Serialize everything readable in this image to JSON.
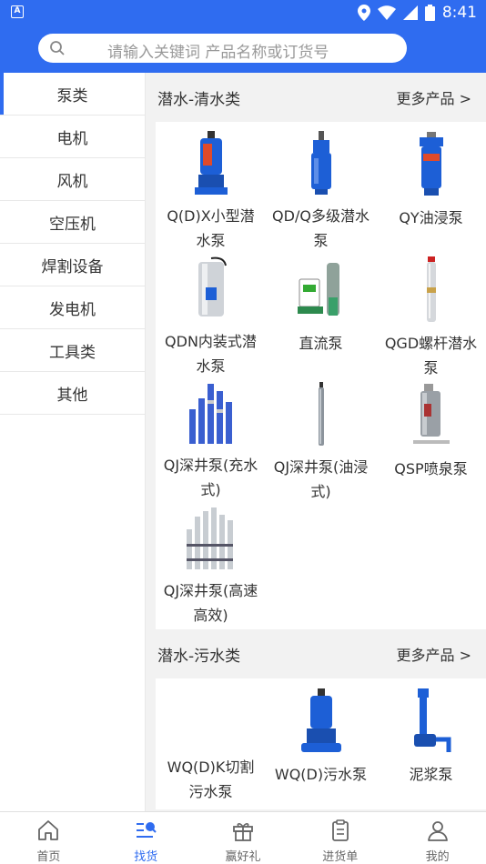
{
  "status_bar": {
    "time": "8:41",
    "app_badge": "A"
  },
  "search": {
    "placeholder": "请输入关键词 产品名称或订货号"
  },
  "sidebar": {
    "items": [
      {
        "label": "泵类",
        "active": true
      },
      {
        "label": "电机"
      },
      {
        "label": "风机"
      },
      {
        "label": "空压机"
      },
      {
        "label": "焊割设备"
      },
      {
        "label": "发电机"
      },
      {
        "label": "工具类"
      },
      {
        "label": "其他"
      }
    ]
  },
  "sections": [
    {
      "title": "潜水-清水类",
      "more": "更多产品 >",
      "products": [
        {
          "label": "Q(D)X小型潜水泵"
        },
        {
          "label": "QD/Q多级潜水泵"
        },
        {
          "label": "QY油浸泵"
        },
        {
          "label": "QDN内装式潜水泵"
        },
        {
          "label": "直流泵"
        },
        {
          "label": "QGD螺杆潜水泵"
        },
        {
          "label": "QJ深井泵(充水式)"
        },
        {
          "label": "QJ深井泵(油浸式)"
        },
        {
          "label": "QSP喷泉泵"
        },
        {
          "label": "QJ深井泵(高速高效)"
        }
      ]
    },
    {
      "title": "潜水-污水类",
      "more": "更多产品 >",
      "products": [
        {
          "label": "WQ(D)K切割污水泵"
        },
        {
          "label": "WQ(D)污水泵"
        },
        {
          "label": "泥浆泵"
        }
      ]
    }
  ],
  "tabbar": {
    "items": [
      {
        "label": "首页",
        "icon": "home-icon"
      },
      {
        "label": "找货",
        "icon": "search-list-icon",
        "active": true
      },
      {
        "label": "赢好礼",
        "icon": "gift-icon"
      },
      {
        "label": "进货单",
        "icon": "clipboard-icon"
      },
      {
        "label": "我的",
        "icon": "user-icon"
      }
    ]
  },
  "colors": {
    "accent": "#2f6cf0",
    "pump_blue": "#1d5fd6"
  }
}
